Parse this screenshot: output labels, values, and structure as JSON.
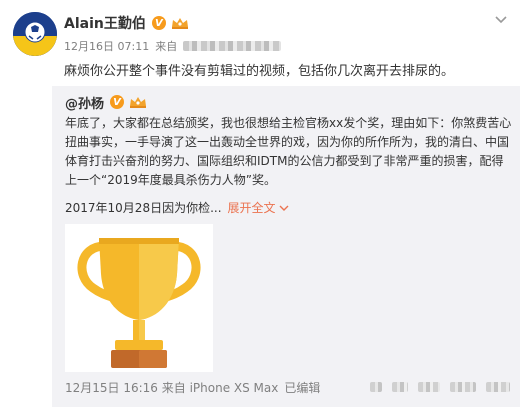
{
  "post": {
    "author_name": "Alain王勤伯",
    "verified_badge": "V",
    "timestamp": "12月16日 07:11",
    "source_prefix": "来自",
    "text": "麻烦你公开整个事件没有剪辑过的视频，包括你几次离开去排尿的。"
  },
  "repost": {
    "author_name": "@孙杨",
    "verified_badge": "V",
    "text": "年底了，大家都在总结颁奖，我也很想给主检官杨xx发个奖，理由如下：你煞费苦心扭曲事实，一手导演了这一出轰动全世界的戏，因为你的所作所为，我的清白、中国体育打击兴奋剂的努力、国际组织和IDTM的公信力都受到了非常严重的损害，配得上一个“2019年度最具杀伤力人物”奖。",
    "quoted_date": "2017年10月28日因为你检",
    "ellipsis": "...",
    "expand_label": "展开全文",
    "footer_time": "12月15日 16:16 来自 iPhone XS Max",
    "edit_label": "已编辑"
  },
  "icons": {
    "avatar": "avatar-portrait",
    "verified": "verified-v-icon",
    "member": "member-crown-icon",
    "menu": "chevron-down-icon",
    "trophy": "trophy-icon"
  },
  "colors": {
    "accent_link": "#eb7350",
    "badge_orange": "#f79b1c",
    "repost_bg": "#f2f2f5",
    "trophy_gold": "#f5b82a"
  }
}
